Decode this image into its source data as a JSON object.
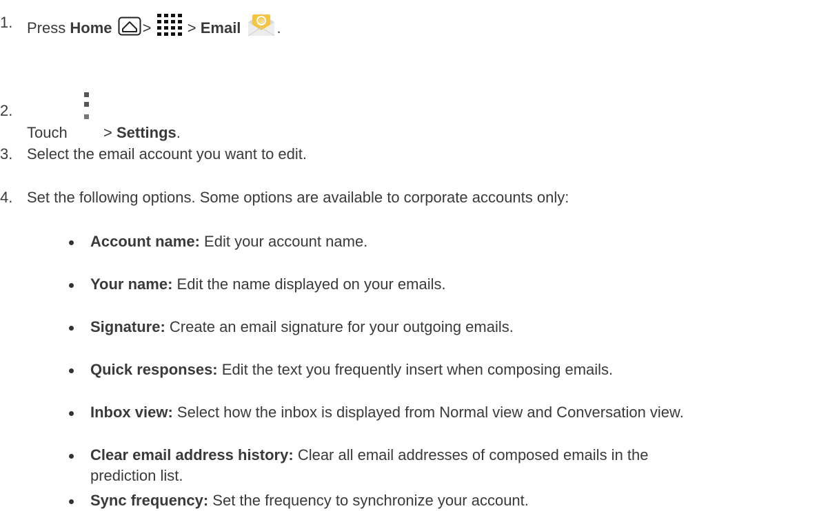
{
  "steps": [
    {
      "number": "1.",
      "prefix": "Press",
      "home_label": "Home",
      "sep1": ">",
      "sep2": ">",
      "email_label": "Email",
      "end": ".",
      "icons": [
        "home-icon",
        "apps-grid-icon",
        "email-app-icon"
      ]
    },
    {
      "number": "2.",
      "prefix": "Touch",
      "sep": ">",
      "settings_label": "Settings",
      "end": ".",
      "icons": [
        "menu-more-icon"
      ]
    },
    {
      "number": "3.",
      "text": "Select the email account you want to edit."
    },
    {
      "number": "4.",
      "text": "Set the following options. Some options are available to corporate accounts only:"
    }
  ],
  "options": [
    {
      "label": "Account name:",
      "desc": "Edit your account name."
    },
    {
      "label": "Your name:",
      "desc": "Edit the name displayed on your emails."
    },
    {
      "label": "Signature:",
      "desc": "Create an email signature for your outgoing emails."
    },
    {
      "label": "Quick responses:",
      "desc": "Edit the text you frequently insert when composing emails."
    },
    {
      "label": "Inbox view:",
      "desc": "Select how the inbox is displayed from Normal view and Conversation view."
    },
    {
      "label": "Clear email address history:",
      "desc": "Clear all email addresses of composed emails in the",
      "desc_cont": "prediction list."
    },
    {
      "label": "Sync frequency:",
      "desc": "Set the frequency to synchronize your account."
    }
  ],
  "colors": {
    "text": "#3a3a3a",
    "email_icon_yellow": "#f5c542",
    "email_icon_envelope": "#e9e9e9"
  }
}
